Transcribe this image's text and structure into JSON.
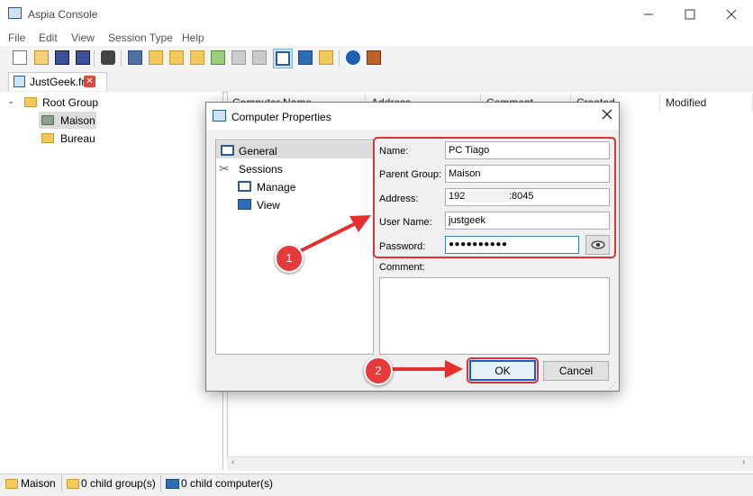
{
  "window": {
    "title": "Aspia Console"
  },
  "menu": [
    "File",
    "Edit",
    "View",
    "Session Type",
    "Help"
  ],
  "tab": {
    "label": "JustGeek.fr"
  },
  "tree": {
    "root": "Root Group",
    "children": [
      "Maison",
      "Bureau"
    ]
  },
  "list": {
    "columns": [
      "Computer Name",
      "Address",
      "Comment",
      "Created",
      "Modified"
    ]
  },
  "status": {
    "group": "Maison",
    "child_groups": "0 child group(s)",
    "child_computers": "0 child computer(s)"
  },
  "dialog": {
    "title": "Computer Properties",
    "nav": {
      "general": "General",
      "sessions": "Sessions",
      "manage": "Manage",
      "view": "View"
    },
    "fields": {
      "name_label": "Name:",
      "name_value": "PC Tiago",
      "parent_label": "Parent Group:",
      "parent_value": "Maison",
      "address_label": "Address:",
      "address_ip_start": "192",
      "address_port": ":8045",
      "username_label": "User Name:",
      "username_value": "justgeek",
      "password_label": "Password:",
      "password_value": "●●●●●●●●●●",
      "comment_label": "Comment:"
    },
    "buttons": {
      "ok": "OK",
      "cancel": "Cancel"
    }
  },
  "annotations": {
    "badge1": "1",
    "badge2": "2",
    "accent": "#e53030"
  }
}
